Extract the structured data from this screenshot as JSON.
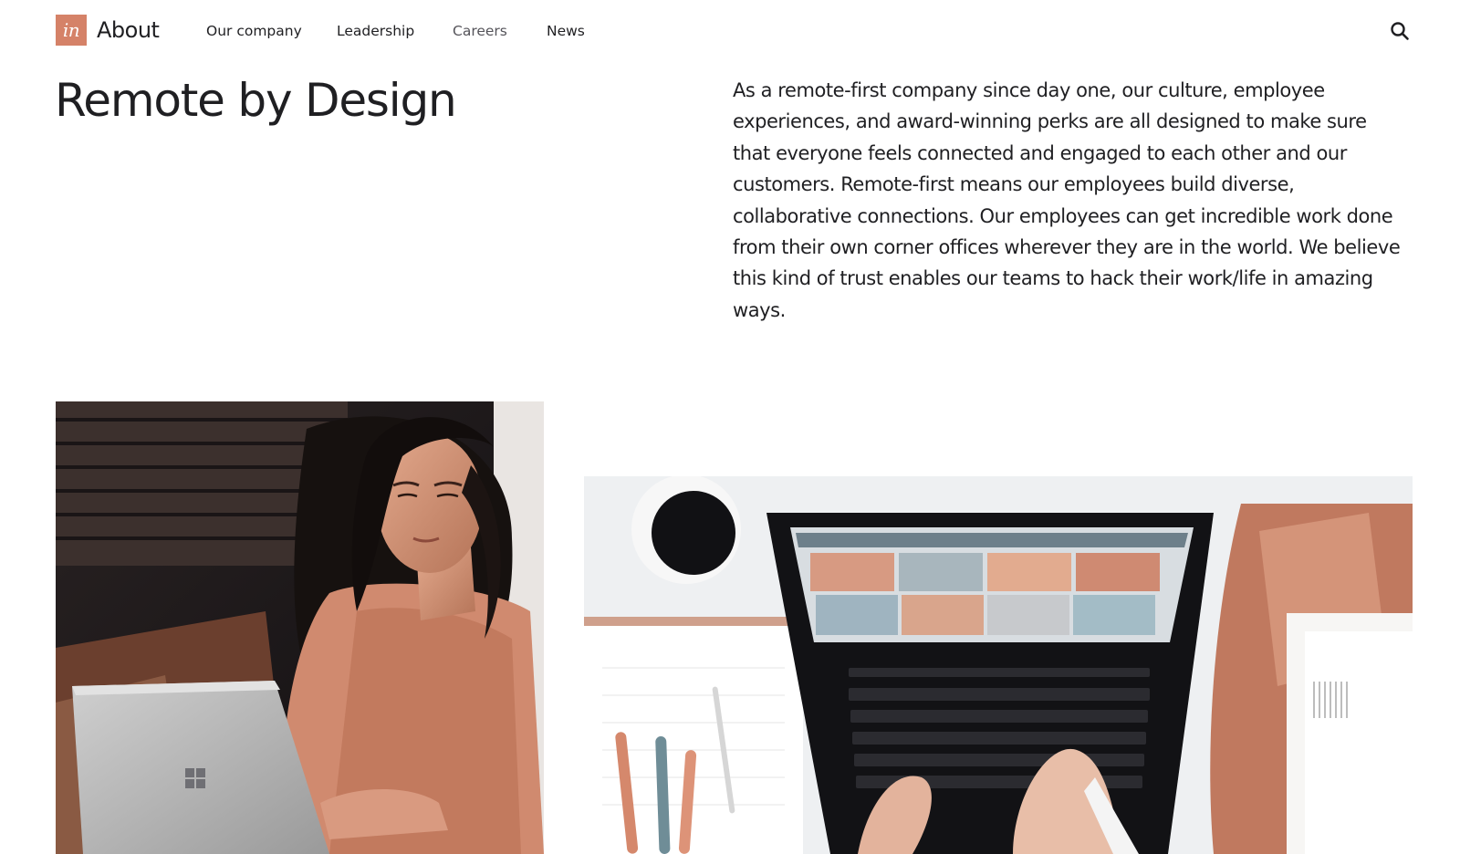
{
  "header": {
    "logo_text": "in",
    "brand": "About",
    "nav": [
      {
        "label": "Our company"
      },
      {
        "label": "Leadership"
      },
      {
        "label": "Careers"
      },
      {
        "label": "News"
      }
    ],
    "search_icon": "search-icon"
  },
  "intro": {
    "title": "Remote by Design",
    "body": "As a remote-first company since day one, our culture, employee experiences, and award-winning perks are all designed to make sure that everyone feels connected and engaged to each other and our customers. Remote-first means our employees build diverse, collaborative connections. Our employees can get incredible work done from their own corner offices wherever they are in the world. We believe this kind of trust enables our teams to hack their work/life in amazing ways."
  },
  "colors": {
    "brand": "#d58268",
    "text": "#1f1f22",
    "muted_nav": "#55545a"
  }
}
